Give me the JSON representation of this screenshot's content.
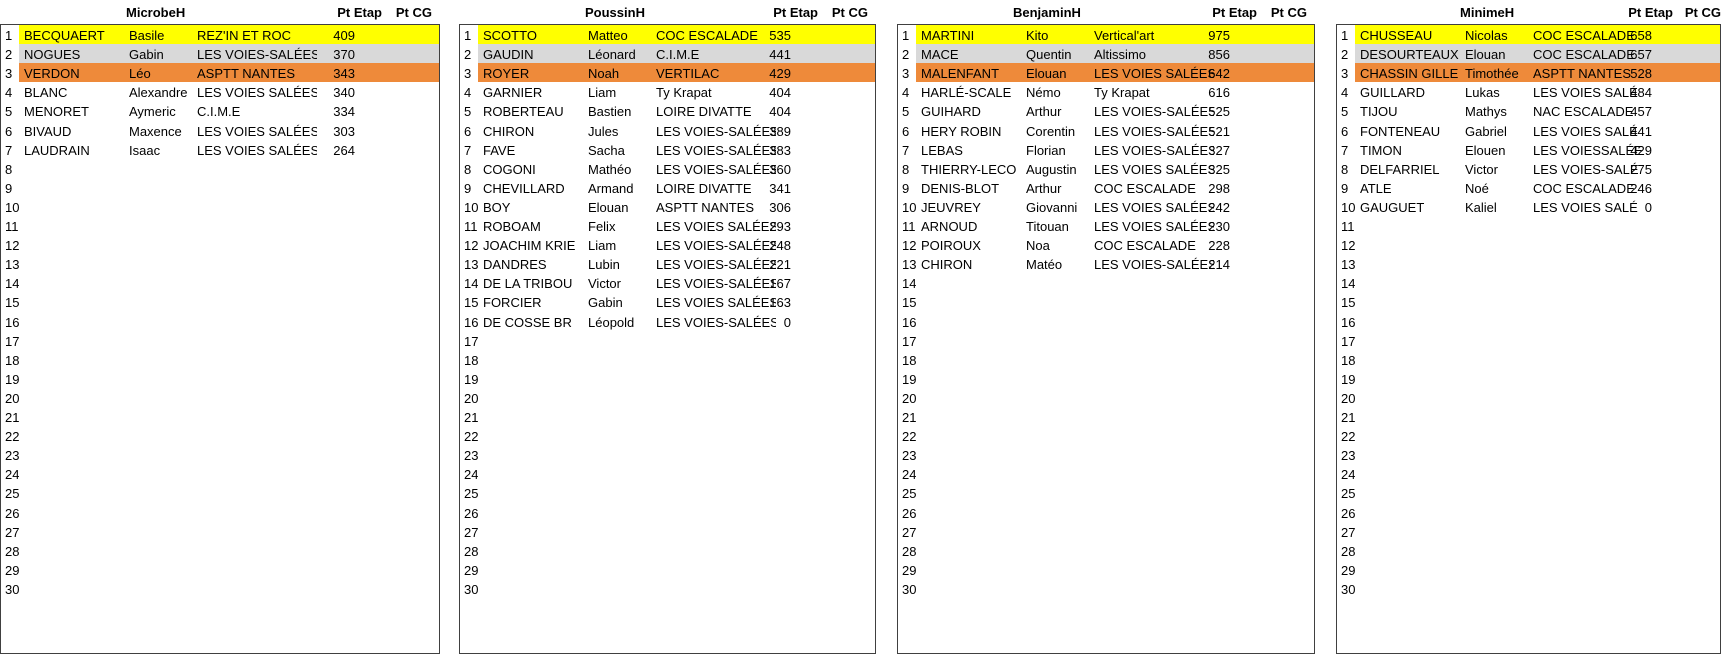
{
  "colors": {
    "first": "#ffff00",
    "second": "#d9d9d9",
    "third": "#ee8a3a"
  },
  "columns": {
    "etap": "Pt Etap",
    "cg": "Pt CG"
  },
  "row_numbers": [
    "1",
    "2",
    "3",
    "4",
    "5",
    "6",
    "7",
    "8",
    "9",
    "10",
    "11",
    "12",
    "13",
    "14",
    "15",
    "16",
    "17",
    "18",
    "19",
    "20",
    "21",
    "22",
    "23",
    "24",
    "25",
    "26",
    "27",
    "28",
    "29",
    "30"
  ],
  "panels": [
    {
      "title": "MicrobeH",
      "rows": [
        {
          "nom": "BECQUAERT",
          "prenom": "Basile",
          "club": "REZ'IN ET ROC",
          "pts": "409"
        },
        {
          "nom": "NOGUES",
          "prenom": "Gabin",
          "club": "LES VOIES-SALÉES",
          "pts": "370"
        },
        {
          "nom": "VERDON",
          "prenom": "Léo",
          "club": "ASPTT NANTES",
          "pts": "343"
        },
        {
          "nom": "BLANC",
          "prenom": "Alexandre",
          "club": "LES VOIES SALÉES",
          "pts": "340"
        },
        {
          "nom": "MENORET",
          "prenom": "Aymeric",
          "club": "C.I.M.E",
          "pts": "334"
        },
        {
          "nom": "BIVAUD",
          "prenom": "Maxence",
          "club": "LES VOIES SALÉES",
          "pts": "303"
        },
        {
          "nom": "LAUDRAIN",
          "prenom": "Isaac",
          "club": "LES VOIES SALÉES",
          "pts": "264"
        }
      ]
    },
    {
      "title": "PoussinH",
      "rows": [
        {
          "nom": "SCOTTO",
          "prenom": "Matteo",
          "club": "COC ESCALADE",
          "pts": "535"
        },
        {
          "nom": "GAUDIN",
          "prenom": "Léonard",
          "club": "C.I.M.E",
          "pts": "441"
        },
        {
          "nom": "ROYER",
          "prenom": "Noah",
          "club": "VERTILAC",
          "pts": "429"
        },
        {
          "nom": "GARNIER",
          "prenom": "Liam",
          "club": "Ty Krapat",
          "pts": "404"
        },
        {
          "nom": "ROBERTEAU",
          "prenom": "Bastien",
          "club": "LOIRE DIVATTE",
          "pts": "404"
        },
        {
          "nom": "CHIRON",
          "prenom": "Jules",
          "club": "LES VOIES-SALÉES",
          "pts": "389"
        },
        {
          "nom": "FAVE",
          "prenom": "Sacha",
          "club": "LES VOIES-SALÉES",
          "pts": "383"
        },
        {
          "nom": "COGONI",
          "prenom": "Mathéo",
          "club": "LES VOIES-SALÉES",
          "pts": "360"
        },
        {
          "nom": "CHEVILLARD",
          "prenom": "Armand",
          "club": "LOIRE DIVATTE",
          "pts": "341"
        },
        {
          "nom": "BOY",
          "prenom": "Elouan",
          "club": "ASPTT NANTES",
          "pts": "306"
        },
        {
          "nom": "ROBOAM",
          "prenom": "Felix",
          "club": "LES VOIES SALÉES",
          "pts": "293"
        },
        {
          "nom": "JOACHIM KRIE",
          "prenom": "Liam",
          "club": "LES VOIES-SALÉES",
          "pts": "248"
        },
        {
          "nom": "DANDRES",
          "prenom": "Lubin",
          "club": "LES VOIES-SALÉES",
          "pts": "221"
        },
        {
          "nom": "DE LA TRIBOU",
          "prenom": "Victor",
          "club": "LES VOIES-SALÉES",
          "pts": "167"
        },
        {
          "nom": "FORCIER",
          "prenom": "Gabin",
          "club": "LES VOIES SALÉES",
          "pts": "163"
        },
        {
          "nom": "DE COSSE BR",
          "prenom": "Léopold",
          "club": "LES VOIES-SALÉES",
          "pts": "0"
        }
      ]
    },
    {
      "title": "BenjaminH",
      "rows": [
        {
          "nom": "MARTINI",
          "prenom": "Kito",
          "club": "Vertical'art",
          "pts": "975"
        },
        {
          "nom": "MACE",
          "prenom": "Quentin",
          "club": "Altissimo",
          "pts": "856"
        },
        {
          "nom": "MALENFANT",
          "prenom": "Elouan",
          "club": "LES VOIES SALÉES",
          "pts": "642"
        },
        {
          "nom": "HARLÉ-SCALE",
          "prenom": "Némo",
          "club": "Ty Krapat",
          "pts": "616"
        },
        {
          "nom": "GUIHARD",
          "prenom": "Arthur",
          "club": "LES VOIES-SALÉES",
          "pts": "525"
        },
        {
          "nom": "HERY ROBIN",
          "prenom": "Corentin",
          "club": "LES VOIES-SALÉES",
          "pts": "521"
        },
        {
          "nom": "LEBAS",
          "prenom": "Florian",
          "club": "LES VOIES-SALÉES",
          "pts": "327"
        },
        {
          "nom": "THIERRY-LECO",
          "prenom": "Augustin",
          "club": "LES VOIES SALÉES",
          "pts": "325"
        },
        {
          "nom": "DENIS-BLOT",
          "prenom": "Arthur",
          "club": "COC ESCALADE",
          "pts": "298"
        },
        {
          "nom": "JEUVREY",
          "prenom": "Giovanni",
          "club": "LES VOIES SALÉES",
          "pts": "242"
        },
        {
          "nom": "ARNOUD",
          "prenom": "Titouan",
          "club": "LES VOIES SALÉES",
          "pts": "230"
        },
        {
          "nom": "POIROUX",
          "prenom": "Noa",
          "club": "COC ESCALADE",
          "pts": "228"
        },
        {
          "nom": "CHIRON",
          "prenom": "Matéo",
          "club": "LES VOIES-SALÉES",
          "pts": "214"
        }
      ]
    },
    {
      "title": "MinimeH",
      "rows": [
        {
          "nom": "CHUSSEAU",
          "prenom": "Nicolas",
          "club": "COC ESCALADE",
          "pts": "658"
        },
        {
          "nom": "DESOURTEAUX",
          "prenom": "Elouan",
          "club": "COC ESCALADE",
          "pts": "657"
        },
        {
          "nom": "CHASSIN GILLE",
          "prenom": "Timothée",
          "club": "ASPTT NANTES",
          "pts": "528"
        },
        {
          "nom": "GUILLARD",
          "prenom": "Lukas",
          "club": "LES VOIES SALÉ",
          "pts": "484"
        },
        {
          "nom": "TIJOU",
          "prenom": "Mathys",
          "club": "NAC ESCALADE",
          "pts": "457"
        },
        {
          "nom": "FONTENEAU",
          "prenom": "Gabriel",
          "club": "LES VOIES SALÉ",
          "pts": "441"
        },
        {
          "nom": "TIMON",
          "prenom": "Elouen",
          "club": "LES VOIESSALÉE",
          "pts": "429"
        },
        {
          "nom": "DELFARRIEL",
          "prenom": "Victor",
          "club": "LES VOIES-SALÉ",
          "pts": "275"
        },
        {
          "nom": "ATLE",
          "prenom": "Noé",
          "club": "COC ESCALADE",
          "pts": "246"
        },
        {
          "nom": "GAUGUET",
          "prenom": "Kaliel",
          "club": "LES VOIES SALÉ",
          "pts": "0"
        }
      ]
    }
  ]
}
